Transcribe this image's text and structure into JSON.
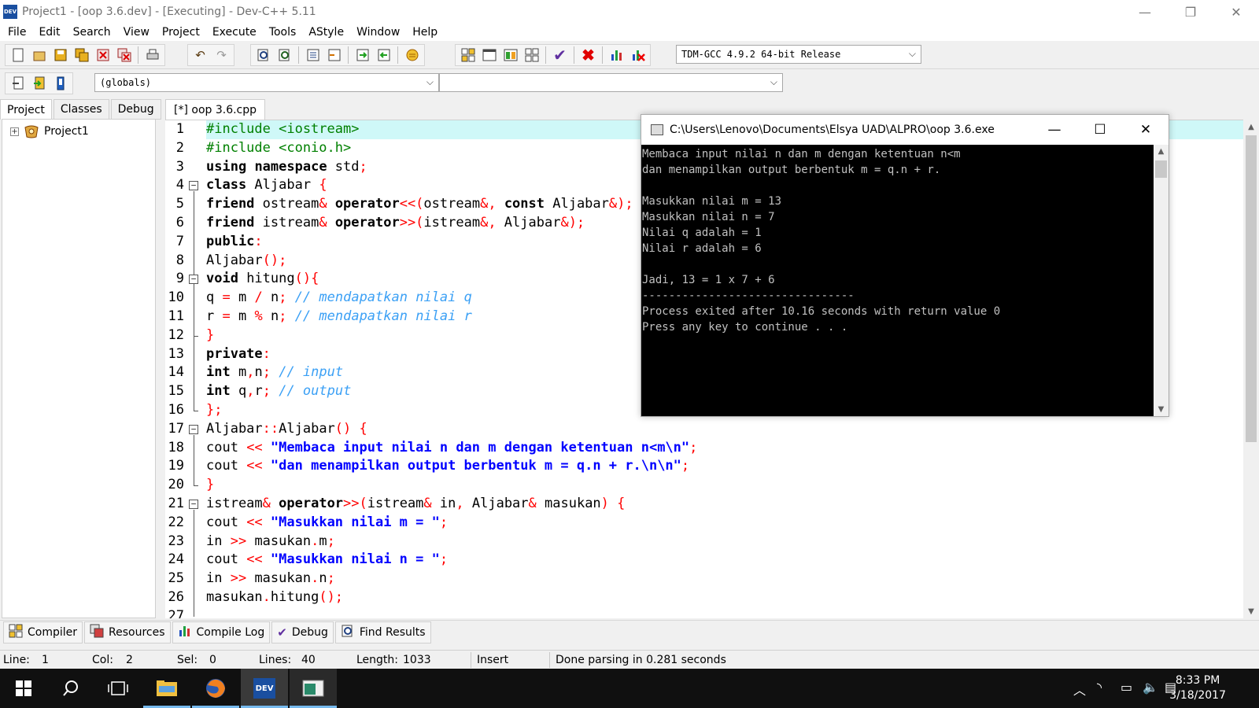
{
  "window": {
    "title": "Project1 - [oop 3.6.dev] - [Executing] - Dev-C++ 5.11",
    "app_icon_text": "DEV"
  },
  "menu": [
    "File",
    "Edit",
    "Search",
    "View",
    "Project",
    "Execute",
    "Tools",
    "AStyle",
    "Window",
    "Help"
  ],
  "toolbar": {
    "compiler_select": "TDM-GCC 4.9.2 64-bit Release",
    "scope_select": "(globals)",
    "function_select": ""
  },
  "left_panel": {
    "tabs": [
      "Project",
      "Classes",
      "Debug"
    ],
    "active_tab": "Project",
    "tree": {
      "expander": "+",
      "project": "Project1"
    }
  },
  "editor": {
    "tab_label": "[*] oop 3.6.cpp",
    "current_line": 1,
    "lines": [
      [
        [
          "#include <iostream>",
          "pp"
        ]
      ],
      [
        [
          "#include <conio.h>",
          "pp"
        ]
      ],
      [
        [
          "using",
          "k"
        ],
        [
          " ",
          ""
        ],
        [
          "namespace",
          "k"
        ],
        [
          " std",
          ""
        ],
        [
          ";",
          "op"
        ]
      ],
      [
        [
          "class",
          "k"
        ],
        [
          " Aljabar ",
          ""
        ],
        [
          "{",
          "op"
        ]
      ],
      [
        [
          "friend",
          "k"
        ],
        [
          " ostream",
          ""
        ],
        [
          "&",
          "op"
        ],
        [
          " ",
          ""
        ],
        [
          "operator",
          "k"
        ],
        [
          "<<(",
          "op"
        ],
        [
          "ostream",
          ""
        ],
        [
          "&,",
          "op"
        ],
        [
          " ",
          ""
        ],
        [
          "const",
          "k"
        ],
        [
          " Aljabar",
          ""
        ],
        [
          "&);",
          "op"
        ]
      ],
      [
        [
          "friend",
          "k"
        ],
        [
          " istream",
          ""
        ],
        [
          "&",
          "op"
        ],
        [
          " ",
          ""
        ],
        [
          "operator",
          "k"
        ],
        [
          ">>(",
          "op"
        ],
        [
          "istream",
          ""
        ],
        [
          "&,",
          "op"
        ],
        [
          " Aljabar",
          ""
        ],
        [
          "&);",
          "op"
        ]
      ],
      [
        [
          "public",
          "k"
        ],
        [
          ":",
          "op"
        ]
      ],
      [
        [
          "Aljabar",
          ""
        ],
        [
          "();",
          "op"
        ]
      ],
      [
        [
          "void",
          "k"
        ],
        [
          " hitung",
          ""
        ],
        [
          "(){",
          "op"
        ]
      ],
      [
        [
          "q ",
          ""
        ],
        [
          "=",
          "op"
        ],
        [
          " m ",
          ""
        ],
        [
          "/",
          "op"
        ],
        [
          " n",
          ""
        ],
        [
          ";",
          "op"
        ],
        [
          " ",
          ""
        ],
        [
          "// mendapatkan nilai q",
          "cm"
        ]
      ],
      [
        [
          "r ",
          ""
        ],
        [
          "=",
          "op"
        ],
        [
          " m ",
          ""
        ],
        [
          "%",
          "op"
        ],
        [
          " n",
          ""
        ],
        [
          ";",
          "op"
        ],
        [
          " ",
          ""
        ],
        [
          "// mendapatkan nilai r",
          "cm"
        ]
      ],
      [
        [
          "}",
          "op"
        ]
      ],
      [
        [
          "private",
          "k"
        ],
        [
          ":",
          "op"
        ]
      ],
      [
        [
          "int",
          "k"
        ],
        [
          " m",
          ""
        ],
        [
          ",",
          "op"
        ],
        [
          "n",
          ""
        ],
        [
          ";",
          "op"
        ],
        [
          " ",
          ""
        ],
        [
          "// input",
          "cm"
        ]
      ],
      [
        [
          "int",
          "k"
        ],
        [
          " q",
          ""
        ],
        [
          ",",
          "op"
        ],
        [
          "r",
          ""
        ],
        [
          ";",
          "op"
        ],
        [
          " ",
          ""
        ],
        [
          "// output",
          "cm"
        ]
      ],
      [
        [
          "};",
          "op"
        ]
      ],
      [
        [
          "Aljabar",
          ""
        ],
        [
          "::",
          "op"
        ],
        [
          "Aljabar",
          ""
        ],
        [
          "()",
          "op"
        ],
        [
          " ",
          ""
        ],
        [
          "{",
          "op"
        ]
      ],
      [
        [
          "cout ",
          ""
        ],
        [
          "<<",
          "op"
        ],
        [
          " ",
          ""
        ],
        [
          "\"Membaca input nilai n dan m dengan ketentuan n<m\\n\"",
          "st"
        ],
        [
          ";",
          "op"
        ]
      ],
      [
        [
          "cout ",
          ""
        ],
        [
          "<<",
          "op"
        ],
        [
          " ",
          ""
        ],
        [
          "\"dan menampilkan output berbentuk m = q.n + r.\\n\\n\"",
          "st"
        ],
        [
          ";",
          "op"
        ]
      ],
      [
        [
          "}",
          "op"
        ]
      ],
      [
        [
          "istream",
          ""
        ],
        [
          "&",
          "op"
        ],
        [
          " ",
          ""
        ],
        [
          "operator",
          "k"
        ],
        [
          ">>(",
          "op"
        ],
        [
          "istream",
          ""
        ],
        [
          "&",
          "op"
        ],
        [
          " in",
          ""
        ],
        [
          ",",
          "op"
        ],
        [
          " Aljabar",
          ""
        ],
        [
          "&",
          "op"
        ],
        [
          " masukan",
          ""
        ],
        [
          ")",
          "op"
        ],
        [
          " ",
          ""
        ],
        [
          "{",
          "op"
        ]
      ],
      [
        [
          "cout ",
          ""
        ],
        [
          "<<",
          "op"
        ],
        [
          " ",
          ""
        ],
        [
          "\"Masukkan nilai m = \"",
          "st"
        ],
        [
          ";",
          "op"
        ]
      ],
      [
        [
          "in ",
          ""
        ],
        [
          ">>",
          "op"
        ],
        [
          " masukan",
          ""
        ],
        [
          ".",
          "op"
        ],
        [
          "m",
          ""
        ],
        [
          ";",
          "op"
        ]
      ],
      [
        [
          "cout ",
          ""
        ],
        [
          "<<",
          "op"
        ],
        [
          " ",
          ""
        ],
        [
          "\"Masukkan nilai n = \"",
          "st"
        ],
        [
          ";",
          "op"
        ]
      ],
      [
        [
          "in ",
          ""
        ],
        [
          ">>",
          "op"
        ],
        [
          " masukan",
          ""
        ],
        [
          ".",
          "op"
        ],
        [
          "n",
          ""
        ],
        [
          ";",
          "op"
        ]
      ],
      [
        [
          "masukan",
          ""
        ],
        [
          ".",
          "op"
        ],
        [
          "hitung",
          ""
        ],
        [
          "();",
          "op"
        ]
      ]
    ]
  },
  "console": {
    "title": "C:\\Users\\Lenovo\\Documents\\Elsya UAD\\ALPRO\\oop 3.6.exe",
    "lines": [
      "Membaca input nilai n dan m dengan ketentuan n<m",
      "dan menampilkan output berbentuk m = q.n + r.",
      "",
      "Masukkan nilai m = 13",
      "Masukkan nilai n = 7",
      "Nilai q adalah = 1",
      "Nilai r adalah = 6",
      "",
      "Jadi, 13 = 1 x 7 + 6",
      "--------------------------------",
      "Process exited after 10.16 seconds with return value 0",
      "Press any key to continue . . ."
    ]
  },
  "bottom_tabs": [
    {
      "label": "Compiler",
      "icon": "compiler-icon"
    },
    {
      "label": "Resources",
      "icon": "resources-icon"
    },
    {
      "label": "Compile Log",
      "icon": "chart-icon"
    },
    {
      "label": "Debug",
      "icon": "check-icon"
    },
    {
      "label": "Find Results",
      "icon": "find-icon"
    }
  ],
  "statusbar": {
    "line_label": "Line:",
    "line_value": "1",
    "col_label": "Col:",
    "col_value": "2",
    "sel_label": "Sel:",
    "sel_value": "0",
    "lines_label": "Lines:",
    "lines_value": "40",
    "length_label": "Length:",
    "length_value": "1033",
    "mode": "Insert",
    "message": "Done parsing in 0.281 seconds"
  },
  "taskbar": {
    "devcpp_label": "DEV",
    "time": "8:33 PM",
    "date": "3/18/2017"
  },
  "colors": {
    "current_line": "#cff8f8",
    "preprocessor": "#008000",
    "operator": "#ff0000",
    "comment": "#3ba0f5",
    "string": "#0000ff",
    "taskbar": "#101010",
    "console_bg": "#000000",
    "console_text": "#c0c0c0"
  }
}
